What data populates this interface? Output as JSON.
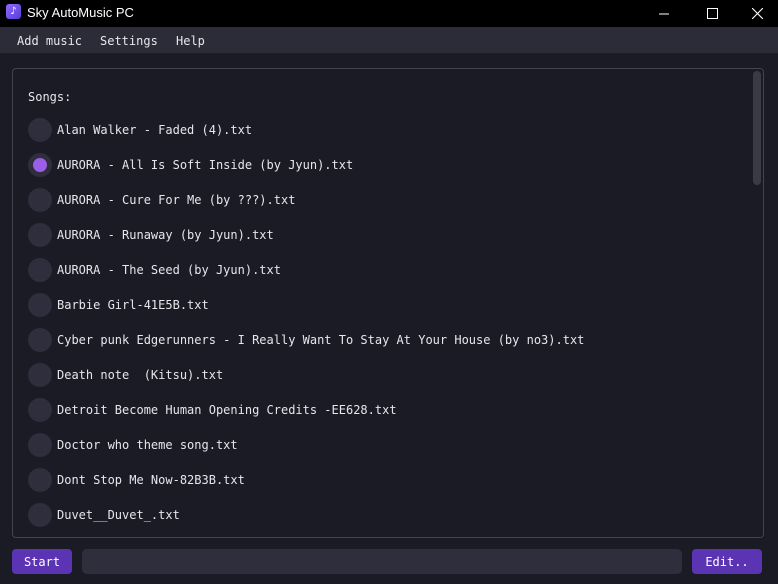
{
  "window": {
    "title": "Sky AutoMusic PC",
    "app_icon_glyph": "♪",
    "app_icon_color": "#7b55f0",
    "controls": [
      "minimize-icon",
      "maximize-icon",
      "close-icon"
    ]
  },
  "menu": {
    "add_music": "Add music",
    "settings": "Settings",
    "help": "Help"
  },
  "songs": {
    "label": "Songs:",
    "selected_index": 1,
    "items": [
      "Alan Walker - Faded (4).txt",
      "AURORA - All Is Soft Inside (by Jyun).txt",
      "AURORA - Cure For Me (by ???).txt",
      "AURORA - Runaway (by Jyun).txt",
      "AURORA - The Seed (by Jyun).txt",
      "Barbie Girl-41E5B.txt",
      "Cyber punk Edgerunners - I Really Want To Stay At Your House (by no3).txt",
      "Death note  (Kitsu).txt",
      "Detroit Become Human Opening Credits -EE628.txt",
      "Doctor who theme song.txt",
      "Dont Stop Me Now-82B3B.txt",
      "Duvet__Duvet_.txt"
    ]
  },
  "controls": {
    "start_label": "Start",
    "edit_label": "Edit..",
    "progress": 0
  },
  "colors": {
    "background": "#1b1b25",
    "accent": "#5b34b3",
    "radio_selected": "#9a5fe6",
    "menubar": "#2c2c38"
  }
}
